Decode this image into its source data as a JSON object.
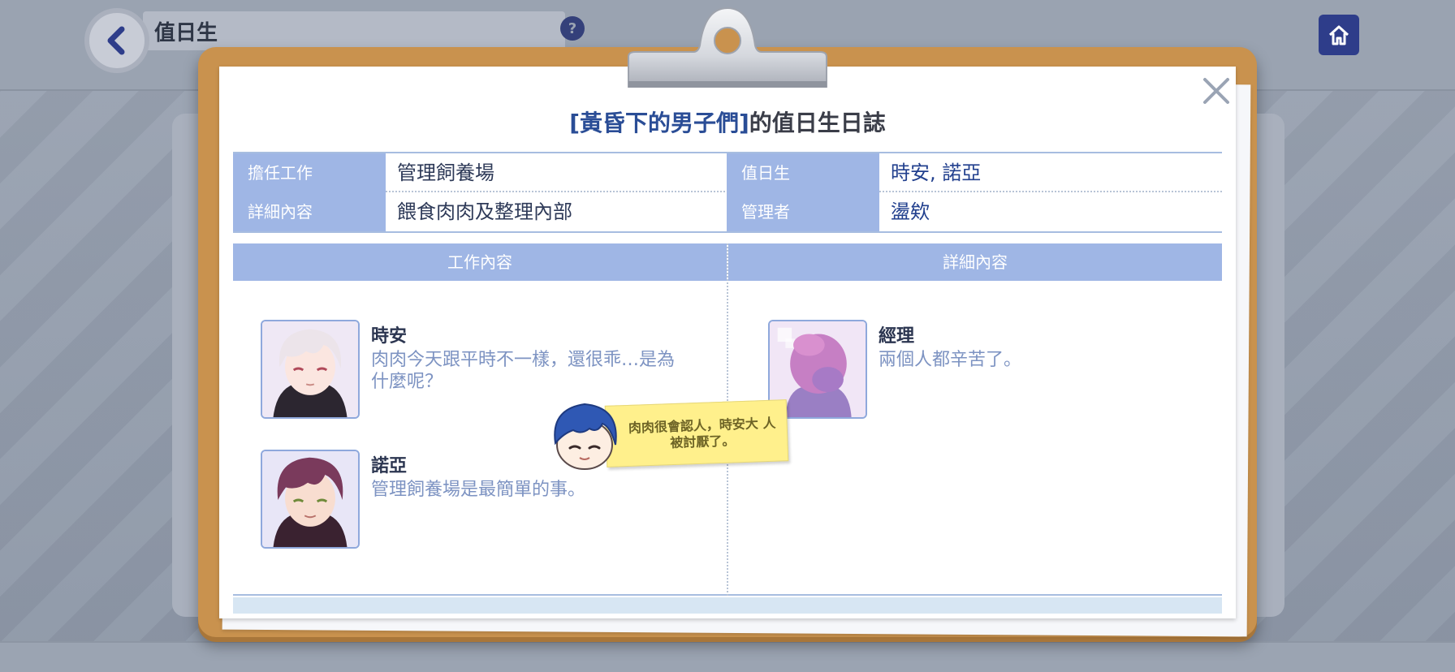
{
  "background": {
    "screen_title": "值日生",
    "back_icon": "back-arrow-icon",
    "help_icon": "question-icon",
    "home_icon": "home-icon"
  },
  "dialog": {
    "title_highlight": "[黃昏下的男子們]",
    "title_rest": "的值日生日誌",
    "close_icon": "close-icon"
  },
  "info": {
    "job_label": "擔任工作",
    "job_value": "管理飼養場",
    "duty_label": "值日生",
    "duty_value": "時安, 諾亞",
    "detail_label": "詳細內容",
    "detail_value": "餵食肉肉及整理內部",
    "manager_label": "管理者",
    "manager_value": "盪欸"
  },
  "columns": {
    "left_header": "工作內容",
    "right_header": "詳細內容"
  },
  "entries": [
    {
      "name": "時安",
      "message": "肉肉今天跟平時不一樣，還很乖…是為什麼呢？"
    },
    {
      "name": "諾亞",
      "message": "管理飼養場是最簡單的事。"
    },
    {
      "name": "經理",
      "message": "兩個人都辛苦了。"
    }
  ],
  "sticky_note": {
    "text": "肉肉很會認人，時安大 人被討厭了。"
  },
  "colors": {
    "clipboard": "#c9924e",
    "header_band": "#9fb6e5",
    "title_highlight": "#2a4d96",
    "message_text": "#7d93c2",
    "sticky": "#fff08c"
  }
}
